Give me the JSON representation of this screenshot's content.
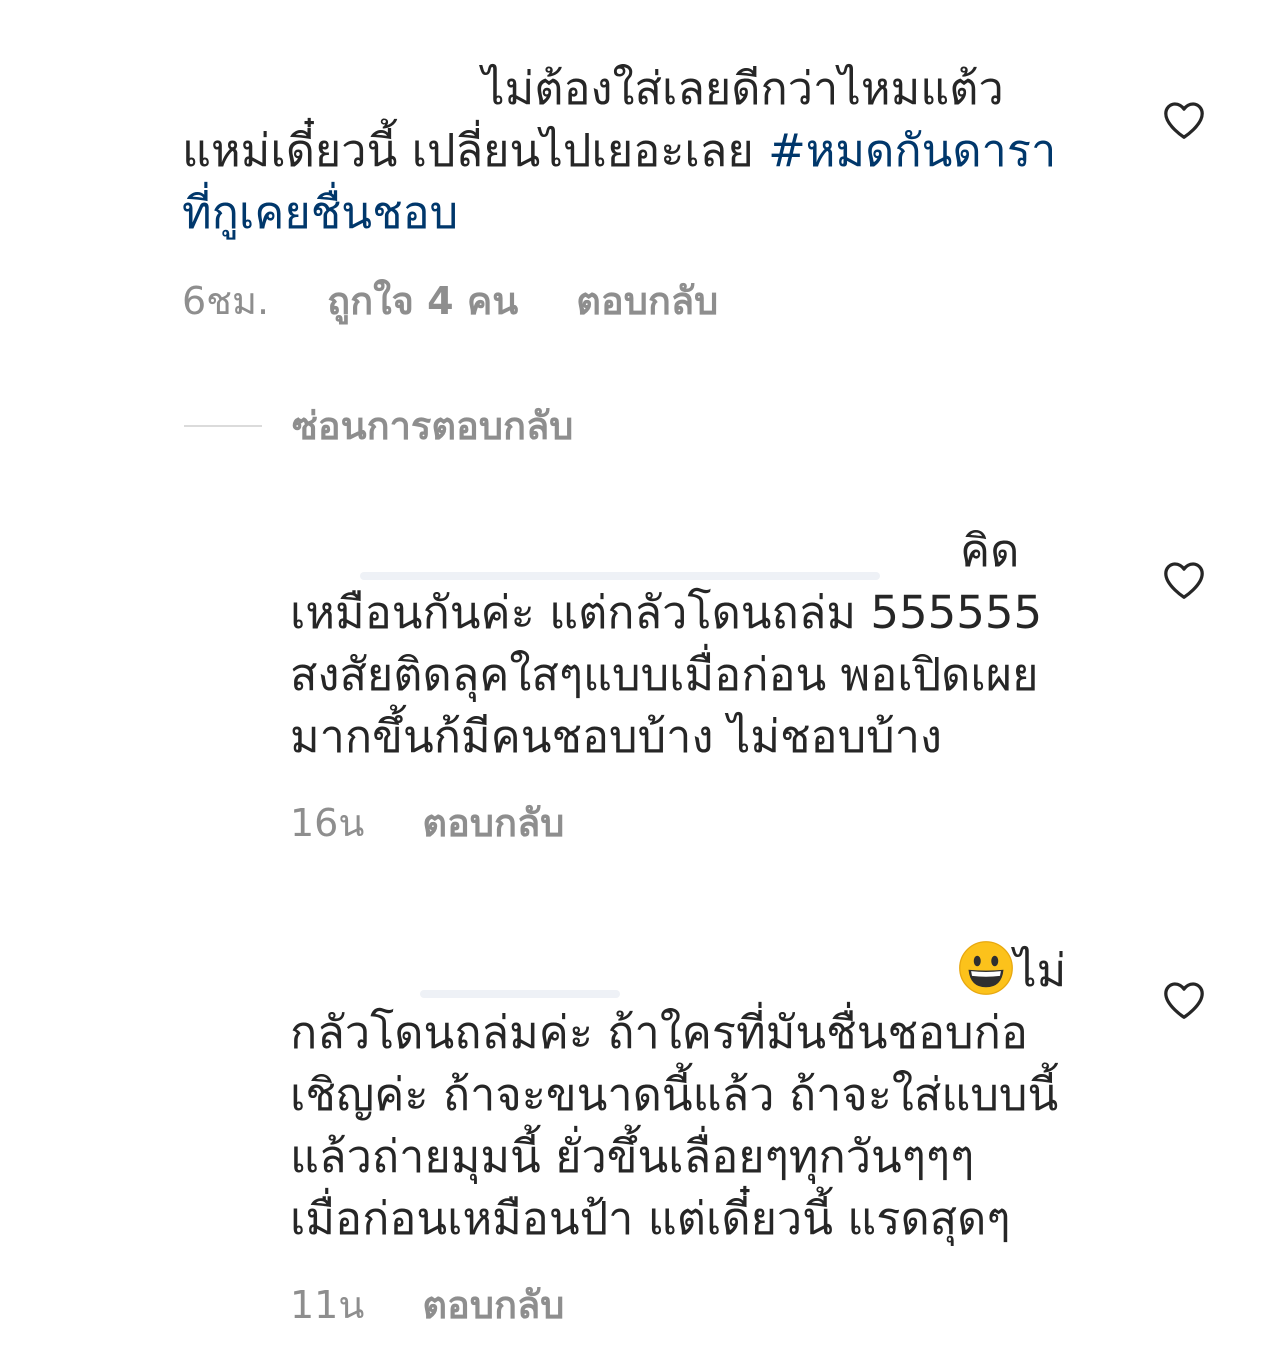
{
  "comments": [
    {
      "lines": [
        "ไม่ต้องใส่เลยดีกว่าไหมแต้ว",
        "แหม่เดี๋ยวนี้ เปลี่ยนไปเยอะเลย ",
        "ที่กูเคยชื่นชอบ"
      ],
      "hashtag": "#หมดกันดารา",
      "time": "6ชม.",
      "likes": "ถูกใจ 4 คน",
      "reply": "ตอบกลับ"
    },
    {
      "lines": [
        "คิด",
        "เหมือนกันค่ะ แต่กลัวโดนถล่ม 555555",
        "สงสัยติดลุคใสๆแบบเมื่อก่อน พอเปิดเผย",
        "มากขึ้นก้มีคนชอบบ้าง ไม่ชอบบ้าง"
      ],
      "time": "16น",
      "reply": "ตอบกลับ"
    },
    {
      "lines": [
        "ไม่",
        "กลัวโดนถล่มค่ะ  ถ้าใครที่มันชื่นชอบก่อ",
        "เชิญค่ะ ถ้าจะขนาดนี้แล้ว  ถ้าจะใส่แบบนี้",
        "แล้วถ่ายมุมนี้ ยั่วขึ้นเลื่อยๆทุกวันๆๆๆ",
        "เมื่อก่อนเหมือนป้า แต่เดี๋ยวนี้ แรดสุดๆ"
      ],
      "emoji": "grinning-face",
      "time": "11น",
      "reply": "ตอบกลับ"
    }
  ],
  "hide_replies_label": "ซ่อนการตอบกลับ",
  "icons": {
    "like": "heart-outline-icon"
  },
  "colors": {
    "text": "#262626",
    "meta": "#8e8e8e",
    "hashtag": "#00376b"
  }
}
